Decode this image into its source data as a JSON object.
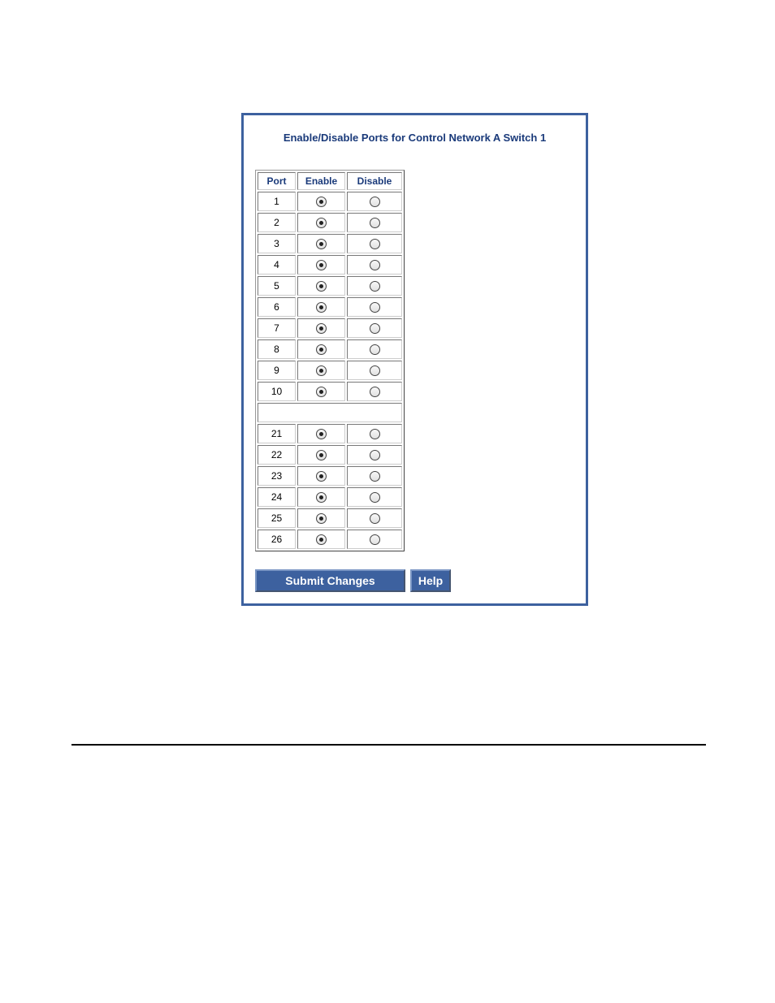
{
  "title": "Enable/Disable Ports for Control Network A Switch 1",
  "table": {
    "headers": {
      "port": "Port",
      "enable": "Enable",
      "disable": "Disable"
    },
    "group1": [
      {
        "port": "1",
        "enabled": true
      },
      {
        "port": "2",
        "enabled": true
      },
      {
        "port": "3",
        "enabled": true
      },
      {
        "port": "4",
        "enabled": true
      },
      {
        "port": "5",
        "enabled": true
      },
      {
        "port": "6",
        "enabled": true
      },
      {
        "port": "7",
        "enabled": true
      },
      {
        "port": "8",
        "enabled": true
      },
      {
        "port": "9",
        "enabled": true
      },
      {
        "port": "10",
        "enabled": true
      }
    ],
    "group2": [
      {
        "port": "21",
        "enabled": true
      },
      {
        "port": "22",
        "enabled": true
      },
      {
        "port": "23",
        "enabled": true
      },
      {
        "port": "24",
        "enabled": true
      },
      {
        "port": "25",
        "enabled": true
      },
      {
        "port": "26",
        "enabled": true
      }
    ]
  },
  "buttons": {
    "submit": "Submit Changes",
    "help": "Help"
  }
}
